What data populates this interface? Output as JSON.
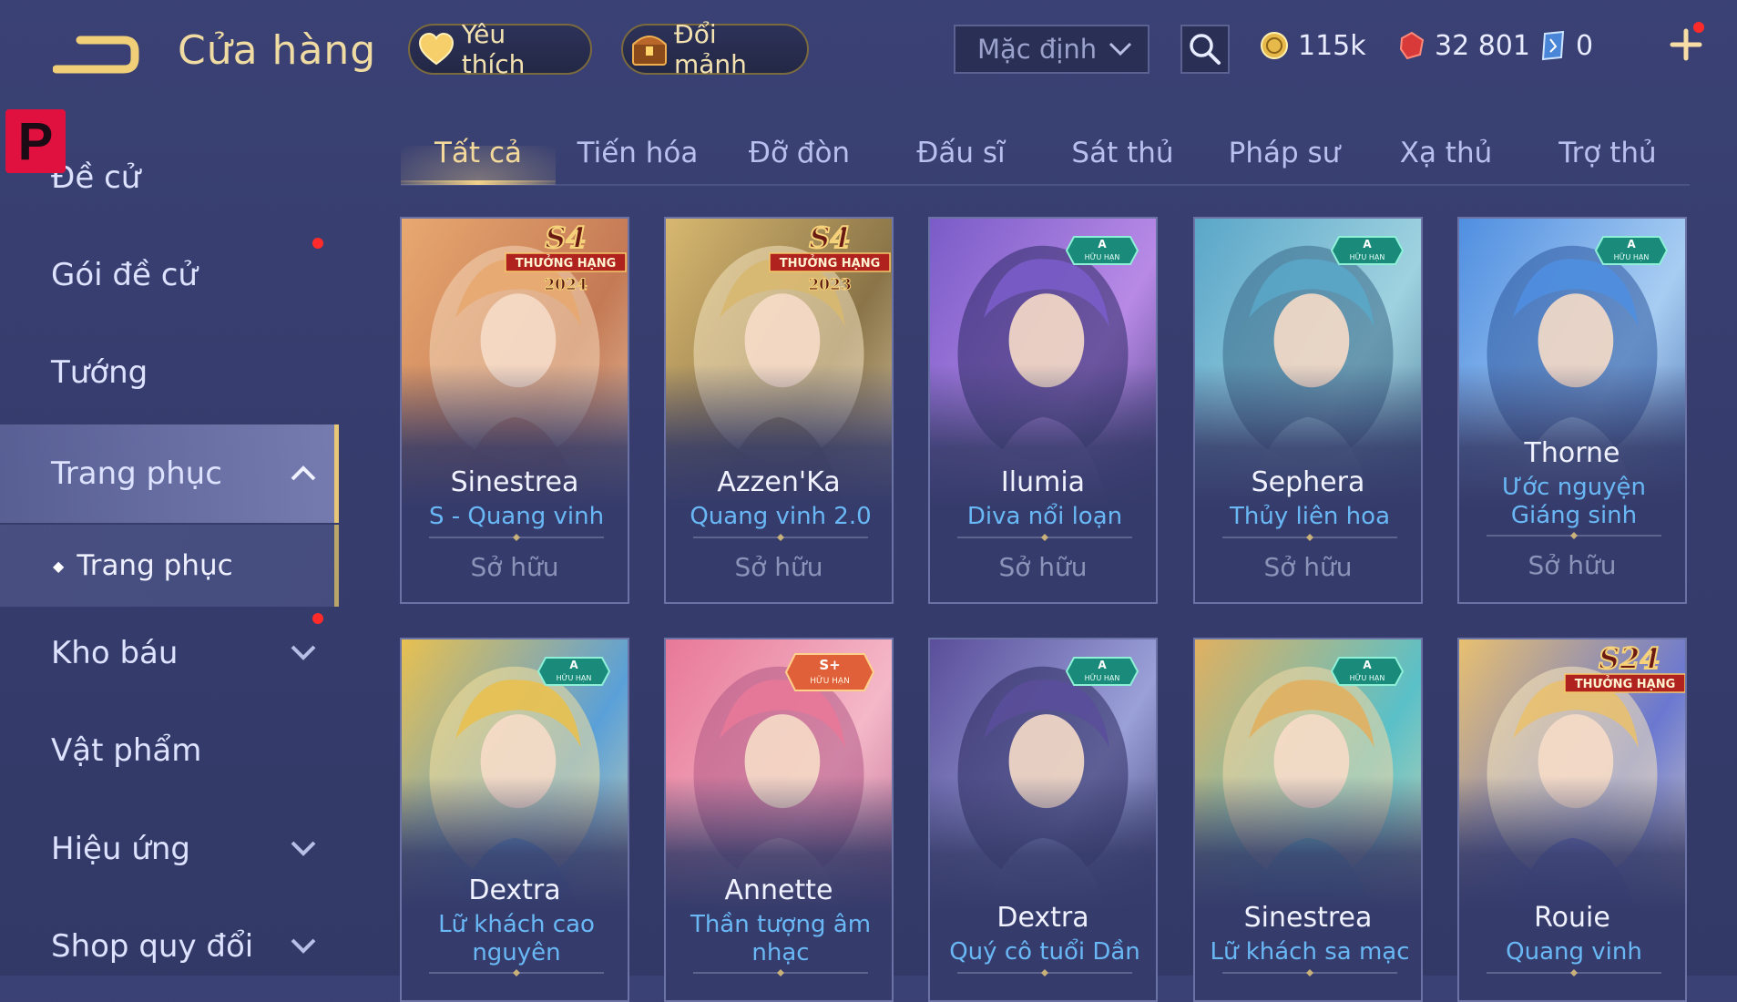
{
  "header": {
    "title": "Cửa hàng",
    "favorites_label": "Yêu thích",
    "fragments_label": "Đổi mảnh",
    "sort_selected": "Mặc định",
    "currency": {
      "gold": "115k",
      "ruby": "32 801",
      "voucher": "0"
    }
  },
  "logo_badge": "P",
  "sidebar": {
    "items": [
      {
        "label": "Đề cử"
      },
      {
        "label": "Gói đề cử"
      },
      {
        "label": "Tướng"
      },
      {
        "label": "Trang phục"
      },
      {
        "label": "Kho báu"
      },
      {
        "label": "Vật phẩm"
      },
      {
        "label": "Hiệu ứng"
      },
      {
        "label": "Shop quy đổi"
      }
    ],
    "sub_item": "Trang phục"
  },
  "tabs": [
    "Tất cả",
    "Tiến hóa",
    "Đỡ đòn",
    "Đấu sĩ",
    "Sát thủ",
    "Pháp sư",
    "Xạ thủ",
    "Trợ thủ"
  ],
  "active_tab": "Tất cả",
  "cards": [
    {
      "hero": "Sinestrea",
      "skin": "S - Quang vinh",
      "status": "Sở hữu",
      "badge": "S4",
      "badge_line": "THƯỞNG HẠNG",
      "badge_year": "2024",
      "palette": [
        "#e8a870",
        "#c47a55",
        "#f3d6b8"
      ]
    },
    {
      "hero": "Azzen'Ka",
      "skin": "Quang vinh 2.0",
      "status": "Sở hữu",
      "badge": "S4",
      "badge_line": "THƯỞNG HẠNG",
      "badge_year": "2023",
      "palette": [
        "#d8b870",
        "#8a7448",
        "#f2e2c0"
      ]
    },
    {
      "hero": "Ilumia",
      "skin": "Diva nổi loạn",
      "status": "Sở hữu",
      "badge": "A",
      "badge_line": "HỮU HẠN",
      "palette": [
        "#7a5cc8",
        "#b88ae6",
        "#2d2a66"
      ]
    },
    {
      "hero": "Sephera",
      "skin": "Thủy liên hoa",
      "status": "Sở hữu",
      "badge": "A",
      "badge_line": "HỮU HẠN",
      "palette": [
        "#5aa6c8",
        "#9fd2e0",
        "#3a6a88"
      ]
    },
    {
      "hero": "Thorne",
      "skin": "Ước nguyện Giáng sinh",
      "status": "Sở hữu",
      "badge": "A",
      "badge_line": "HỮU HẠN",
      "palette": [
        "#4f8ee0",
        "#a8cdf2",
        "#2f5aa0"
      ]
    },
    {
      "hero": "Dextra",
      "skin": "Lữ khách cao nguyên",
      "badge": "A",
      "badge_line": "HỮU HẠN",
      "palette": [
        "#e8c050",
        "#5aa0d8",
        "#f3e0a0"
      ]
    },
    {
      "hero": "Annette",
      "skin": "Thần tượng âm nhạc",
      "badge": "S+",
      "badge_line": "HỮU HẠN",
      "palette": [
        "#e87898",
        "#f4b8c8",
        "#b25a86"
      ]
    },
    {
      "hero": "Dextra",
      "skin": "Quý cô tuổi Dần",
      "badge": "A",
      "badge_line": "HỮU HẠN",
      "palette": [
        "#5a4e9a",
        "#9aa0d8",
        "#2b2a5e"
      ]
    },
    {
      "hero": "Sinestrea",
      "skin": "Lữ khách sa mạc",
      "badge": "A",
      "badge_line": "HỮU HẠN",
      "palette": [
        "#e0b060",
        "#5ac0c8",
        "#f2d8a8"
      ]
    },
    {
      "hero": "Rouie",
      "skin": "Quang vinh",
      "badge": "S24",
      "badge_line": "THƯỞNG HẠNG",
      "palette": [
        "#e8c070",
        "#6a78d0",
        "#f6e6c0"
      ]
    }
  ],
  "colors": {
    "accent_gold": "#f0dca2",
    "skin_blue": "#69b8f5",
    "notification_red": "#ff2b2b",
    "brand_red": "#e0113e"
  }
}
